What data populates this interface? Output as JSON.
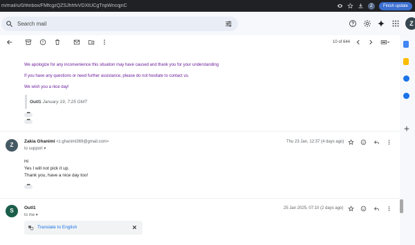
{
  "browser": {
    "url": "m/mail/u/0/#inbox/FMfcgzQZSJhhfvVDXtUCgTnpWncqjnC",
    "avatar_letter": "Z",
    "finish_update_label": "Finish update"
  },
  "header": {
    "search_placeholder": "Search mail",
    "avatar_letter": "Z"
  },
  "toolbar": {
    "count": "10 of 644"
  },
  "message1": {
    "line1": "We apologize for any inconvenience this situation may have caused and thank you for your understanding",
    "line2": "If you have any questions or need further assistance, please do not hesitate to contact us.",
    "line3": "We wish you a nice day!",
    "quote_sender": "Outl1",
    "quote_date": "January 19, 7:25 GMT",
    "dots": "•••"
  },
  "message2": {
    "avatar_letter": "Z",
    "avatar_color": "#455a64",
    "sender_name": "Zakia Ghanimi",
    "sender_email": "<z.ghanimi369@gmail.com>",
    "to": "to support",
    "date": "Thu 23 Jan, 12:37 (4 days ago)",
    "body_lines": [
      "Hi",
      "Yes I will not pick it up.",
      "Thank you, have a nice day too!"
    ],
    "dots": "•••"
  },
  "message3": {
    "avatar_letter": "S",
    "avatar_color": "#1b5e4a",
    "sender_name": "Outl1",
    "to": "to me",
    "date": "25 Jan 2025, 07:10 (2 days ago)",
    "translate_label": "Translate to English"
  }
}
